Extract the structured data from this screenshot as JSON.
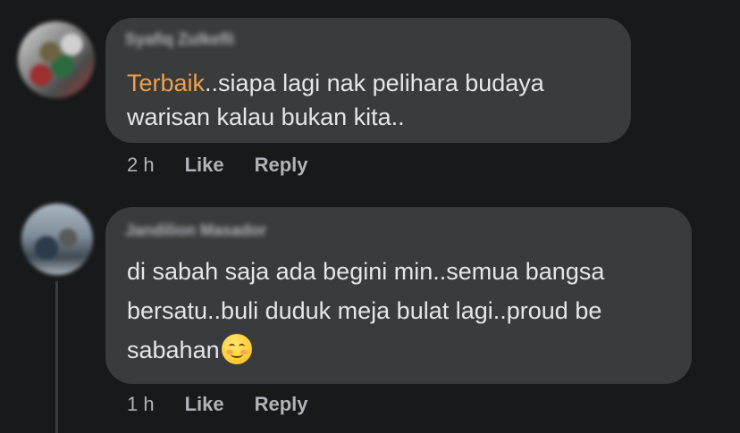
{
  "comments": [
    {
      "author": "Syafiq Zulkefli",
      "highlight": "Terbaik",
      "text": "..siapa lagi nak pelihara budaya warisan kalau bukan kita..",
      "time": "2 h",
      "like_label": "Like",
      "reply_label": "Reply"
    },
    {
      "author": "Jandilion Masador",
      "text_line1": "di sabah saja ada begini min..semua bangsa bersatu..buli duduk meja bulat lagi..proud be",
      "text_line2": "sabahan",
      "emoji": "smiling-face-emoji",
      "time": "1 h",
      "like_label": "Like",
      "reply_label": "Reply"
    }
  ],
  "colors": {
    "background": "#18191a",
    "bubble": "#3a3b3c",
    "text": "#e4e6eb",
    "secondary_text": "#b0b3b8",
    "highlight": "#f0a04b"
  }
}
